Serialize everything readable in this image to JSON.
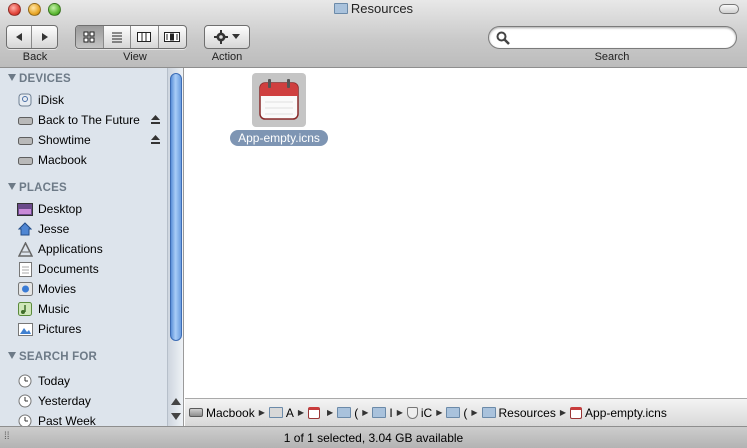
{
  "window": {
    "title": "Resources"
  },
  "toolbar": {
    "back_label": "Back",
    "view_label": "View",
    "action_label": "Action",
    "search_label": "Search",
    "search_value": ""
  },
  "sidebar": {
    "devices_header": "DEVICES",
    "devices": [
      {
        "label": "iDisk",
        "icon": "idisk-icon"
      },
      {
        "label": "Back to The Future",
        "icon": "drive-icon",
        "eject": true
      },
      {
        "label": "Showtime",
        "icon": "drive-icon",
        "eject": true
      },
      {
        "label": "Macbook",
        "icon": "drive-icon"
      }
    ],
    "places_header": "PLACES",
    "places": [
      {
        "label": "Desktop",
        "icon": "desktop-icon"
      },
      {
        "label": "Jesse",
        "icon": "home-icon"
      },
      {
        "label": "Applications",
        "icon": "applications-icon"
      },
      {
        "label": "Documents",
        "icon": "documents-icon"
      },
      {
        "label": "Movies",
        "icon": "movies-icon"
      },
      {
        "label": "Music",
        "icon": "music-icon"
      },
      {
        "label": "Pictures",
        "icon": "pictures-icon"
      }
    ],
    "search_header": "SEARCH FOR",
    "searches": [
      {
        "label": "Today",
        "icon": "clock-icon"
      },
      {
        "label": "Yesterday",
        "icon": "clock-icon"
      },
      {
        "label": "Past Week",
        "icon": "clock-icon"
      }
    ]
  },
  "content": {
    "files": [
      {
        "name": "App-empty.icns",
        "selected": true
      }
    ]
  },
  "pathbar": {
    "items": [
      "Macbook",
      "A",
      "",
      "(",
      "I",
      "iC",
      "(",
      "Resources",
      "App-empty.icns"
    ]
  },
  "status": {
    "text": "1 of 1 selected, 3.04 GB available"
  },
  "colors": {
    "sidebar_bg": "#dde4ec",
    "selection": "#7e95b3",
    "section_header": "#6d7a87"
  }
}
